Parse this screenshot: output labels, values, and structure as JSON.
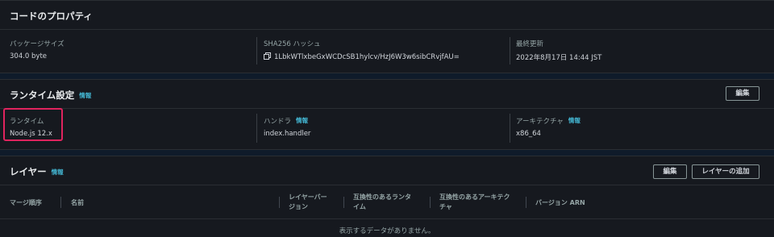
{
  "code_properties": {
    "title": "コードのプロパティ",
    "package_size_label": "パッケージサイズ",
    "package_size_value": "304.0 byte",
    "sha_label": "SHA256 ハッシュ",
    "sha_value": "1LbkWTlxbeGxWCDcSB1hylcv/HzJ6W3w6sibCRvjfAU=",
    "last_modified_label": "最終更新",
    "last_modified_value": "2022年8月17日 14:44 JST"
  },
  "runtime_settings": {
    "title": "ランタイム設定",
    "info": "情報",
    "edit_button": "編集",
    "runtime_label": "ランタイム",
    "runtime_value": "Node.js 12.x",
    "handler_label": "ハンドラ",
    "handler_info": "情報",
    "handler_value": "index.handler",
    "architecture_label": "アーキテクチャ",
    "architecture_info": "情報",
    "architecture_value": "x86_64"
  },
  "layers": {
    "title": "レイヤー",
    "info": "情報",
    "edit_button": "編集",
    "add_layer_button": "レイヤーの追加",
    "columns": {
      "merge_order": "マージ順序",
      "name": "名前",
      "layer_version_line1": "レイヤーバー",
      "layer_version_line2": "ジョン",
      "compat_runtime_line1": "互換性のあるランタ",
      "compat_runtime_line2": "イム",
      "compat_arch_line1": "互換性のあるアーキテク",
      "compat_arch_line2": "チャ",
      "version_arn": "バージョン ARN"
    },
    "empty_message": "表示するデータがありません。"
  },
  "colors": {
    "page_bg": "#0f1b2a",
    "panel_bg": "#16191f",
    "info_link": "#44b9d6",
    "highlight": "#e0245e"
  },
  "icons": {
    "copy": "copy-icon"
  }
}
